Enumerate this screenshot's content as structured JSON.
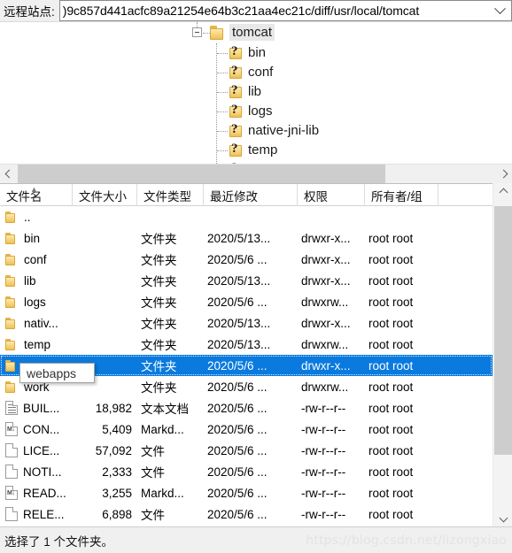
{
  "address": {
    "label": "远程站点:",
    "value": ")9c857d441acfc89a21254e64b3c21aa4ec21c/diff/usr/local/tomcat",
    "dropdown_icon": "chevron-down-icon"
  },
  "tree": {
    "root": {
      "label": "tomcat",
      "icon": "folder-icon",
      "expander": "minus-box",
      "selected": true
    },
    "children": [
      {
        "label": "bin",
        "icon": "folder-question-icon"
      },
      {
        "label": "conf",
        "icon": "folder-question-icon"
      },
      {
        "label": "lib",
        "icon": "folder-question-icon"
      },
      {
        "label": "logs",
        "icon": "folder-question-icon"
      },
      {
        "label": "native-jni-lib",
        "icon": "folder-question-icon"
      },
      {
        "label": "temp",
        "icon": "folder-question-icon"
      },
      {
        "label": "",
        "icon": "folder-question-icon"
      }
    ]
  },
  "hscroll": {
    "left_icon": "arrow-left-icon",
    "right_icon": "arrow-right-icon"
  },
  "vscroll": {
    "up_icon": "arrow-up-icon",
    "down_icon": "arrow-down-icon"
  },
  "list": {
    "columns": [
      {
        "label": "文件名",
        "sort": "▲"
      },
      {
        "label": "文件大小"
      },
      {
        "label": "文件类型"
      },
      {
        "label": "最近修改"
      },
      {
        "label": "权限"
      },
      {
        "label": "所有者/组"
      },
      {
        "label": ""
      }
    ],
    "rows": [
      {
        "name": "..",
        "icon": "folder-icon",
        "size": "",
        "type": "",
        "modified": "",
        "perm": "",
        "owner": ""
      },
      {
        "name": "bin",
        "icon": "folder-icon",
        "size": "",
        "type": "文件夹",
        "modified": "2020/5/13...",
        "perm": "drwxr-x...",
        "owner": "root root"
      },
      {
        "name": "conf",
        "icon": "folder-icon",
        "size": "",
        "type": "文件夹",
        "modified": "2020/5/6 ...",
        "perm": "drwxr-x...",
        "owner": "root root"
      },
      {
        "name": "lib",
        "icon": "folder-icon",
        "size": "",
        "type": "文件夹",
        "modified": "2020/5/13...",
        "perm": "drwxr-x...",
        "owner": "root root"
      },
      {
        "name": "logs",
        "icon": "folder-icon",
        "size": "",
        "type": "文件夹",
        "modified": "2020/5/6 ...",
        "perm": "drwxrw...",
        "owner": "root root"
      },
      {
        "name": "nativ...",
        "icon": "folder-icon",
        "size": "",
        "type": "文件夹",
        "modified": "2020/5/13...",
        "perm": "drwxr-x...",
        "owner": "root root"
      },
      {
        "name": "temp",
        "icon": "folder-icon",
        "size": "",
        "type": "文件夹",
        "modified": "2020/5/13...",
        "perm": "drwxrw...",
        "owner": "root root"
      },
      {
        "name": "webapps",
        "icon": "folder-icon",
        "size": "",
        "type": "文件夹",
        "modified": "2020/5/6 ...",
        "perm": "drwxr-x...",
        "owner": "root root",
        "selected": true
      },
      {
        "name": "work",
        "icon": "folder-icon",
        "size": "",
        "type": "文件夹",
        "modified": "2020/5/6 ...",
        "perm": "drwxrw...",
        "owner": "root root"
      },
      {
        "name": "BUIL...",
        "icon": "text-document-icon",
        "size": "18,982",
        "type": "文本文档",
        "modified": "2020/5/6 ...",
        "perm": "-rw-r--r--",
        "owner": "root root"
      },
      {
        "name": "CON...",
        "icon": "markdown-file-icon",
        "size": "5,409",
        "type": "Markd...",
        "modified": "2020/5/6 ...",
        "perm": "-rw-r--r--",
        "owner": "root root"
      },
      {
        "name": "LICE...",
        "icon": "file-icon",
        "size": "57,092",
        "type": "文件",
        "modified": "2020/5/6 ...",
        "perm": "-rw-r--r--",
        "owner": "root root"
      },
      {
        "name": "NOTI...",
        "icon": "file-icon",
        "size": "2,333",
        "type": "文件",
        "modified": "2020/5/6 ...",
        "perm": "-rw-r--r--",
        "owner": "root root"
      },
      {
        "name": "READ...",
        "icon": "markdown-file-icon",
        "size": "3,255",
        "type": "Markd...",
        "modified": "2020/5/6 ...",
        "perm": "-rw-r--r--",
        "owner": "root root"
      },
      {
        "name": "RELE...",
        "icon": "file-icon",
        "size": "6,898",
        "type": "文件",
        "modified": "2020/5/6 ...",
        "perm": "-rw-r--r--",
        "owner": "root root"
      }
    ]
  },
  "tooltip": {
    "text": "webapps"
  },
  "status": {
    "text": "选择了 1 个文件夹。",
    "watermark": "https://blog.csdn.net/lizongxiao"
  },
  "colors": {
    "selection": "#0a7ade",
    "folder": "#f7d47a",
    "chrome": "#f0f0f0"
  }
}
